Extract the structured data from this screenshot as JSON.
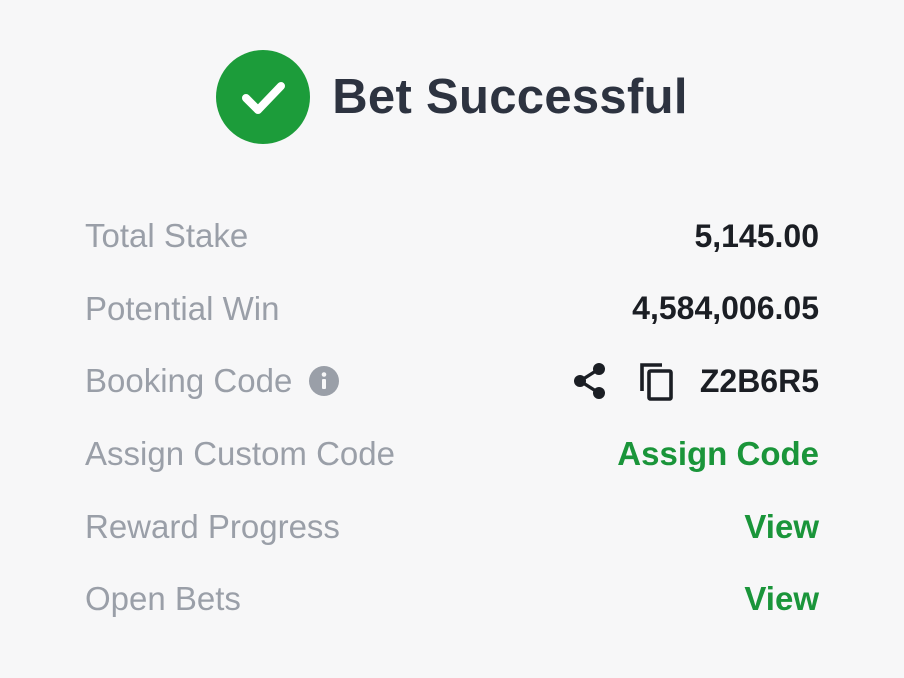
{
  "header": {
    "title": "Bet Successful",
    "icon": "check-circle-icon",
    "icon_color": "#1c9c3a"
  },
  "details": {
    "total_stake": {
      "label": "Total Stake",
      "value": "5,145.00"
    },
    "potential_win": {
      "label": "Potential Win",
      "value": "4,584,006.05"
    },
    "booking_code": {
      "label": "Booking Code",
      "info_icon": "info-icon",
      "share_icon": "share-icon",
      "copy_icon": "copy-icon",
      "value": "Z2B6R5"
    },
    "assign_custom_code": {
      "label": "Assign Custom Code",
      "link": "Assign Code"
    },
    "reward_progress": {
      "label": "Reward Progress",
      "link": "View"
    },
    "open_bets": {
      "label": "Open Bets",
      "link": "View"
    }
  },
  "colors": {
    "accent_green": "#1a953a",
    "label_gray": "#9a9fa8",
    "value_dark": "#1b1e24",
    "background": "#f7f7f8"
  }
}
